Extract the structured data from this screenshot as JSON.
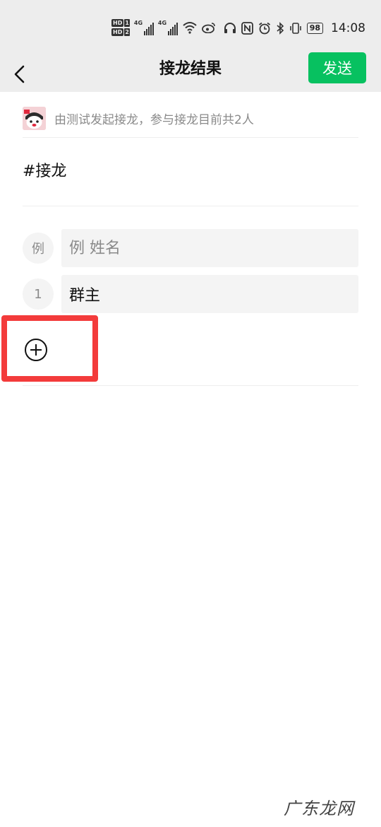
{
  "status_bar": {
    "hd1": "HD",
    "hd1_num": "1",
    "hd2": "HD",
    "hd2_num": "2",
    "net1": "4G",
    "net2": "4G",
    "battery": "98",
    "time": "14:08",
    "icons": [
      "signal-icon",
      "wifi-icon",
      "weibo-icon",
      "headphones-icon",
      "nfc-icon",
      "alarm-icon",
      "bluetooth-icon",
      "vibrate-icon",
      "battery-icon"
    ]
  },
  "navbar": {
    "title": "接龙结果",
    "send_label": "发送",
    "accent": "#07c160"
  },
  "info": {
    "text": "由测试发起接龙，参与接龙目前共2人"
  },
  "topic": "#接龙",
  "entries": [
    {
      "num": "例",
      "placeholder": "例 姓名",
      "value": ""
    },
    {
      "num": "1",
      "placeholder": "",
      "value": "群主"
    }
  ],
  "add_icon": "plus-circle-icon",
  "highlight_color": "#f33b3b",
  "watermark": "广东龙网"
}
